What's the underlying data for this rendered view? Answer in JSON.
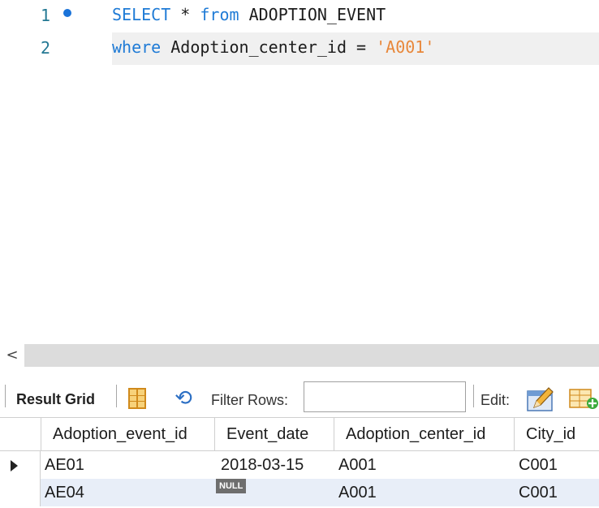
{
  "editor": {
    "lines": [
      {
        "number": "1",
        "tokens": [
          {
            "text": "SELECT",
            "kind": "keyword"
          },
          {
            "text": " * ",
            "kind": "plain"
          },
          {
            "text": "from",
            "kind": "keyword"
          },
          {
            "text": " ADOPTION_EVENT",
            "kind": "plain"
          }
        ]
      },
      {
        "number": "2",
        "tokens": [
          {
            "text": "where",
            "kind": "keyword"
          },
          {
            "text": " Adoption_center_id = ",
            "kind": "plain"
          },
          {
            "text": "'A001'",
            "kind": "string"
          }
        ]
      }
    ],
    "colors": {
      "keyword": "#1f7bd6",
      "string": "#e8873a",
      "plain": "#1c1c1c",
      "line_number": "#237893"
    }
  },
  "scrollbar": {
    "left_arrow": "<"
  },
  "toolbar": {
    "result_grid_label": "Result Grid",
    "grid_icon": "form-grid-icon",
    "refresh_icon": "refresh-icon",
    "filter_label": "Filter Rows:",
    "filter_value": "",
    "edit_label": "Edit:",
    "edit_icon": "edit-pencil-icon",
    "add_row_icon": "add-row-icon"
  },
  "grid": {
    "columns": [
      "Adoption_event_id",
      "Event_date",
      "Adoption_center_id",
      "City_id"
    ],
    "rows": [
      [
        "AE01",
        "2018-03-15",
        "A001",
        "C001"
      ],
      [
        "AE04",
        "NULL",
        "A001",
        "C001"
      ]
    ],
    "selected_row_highlight": "#e8eef8"
  }
}
